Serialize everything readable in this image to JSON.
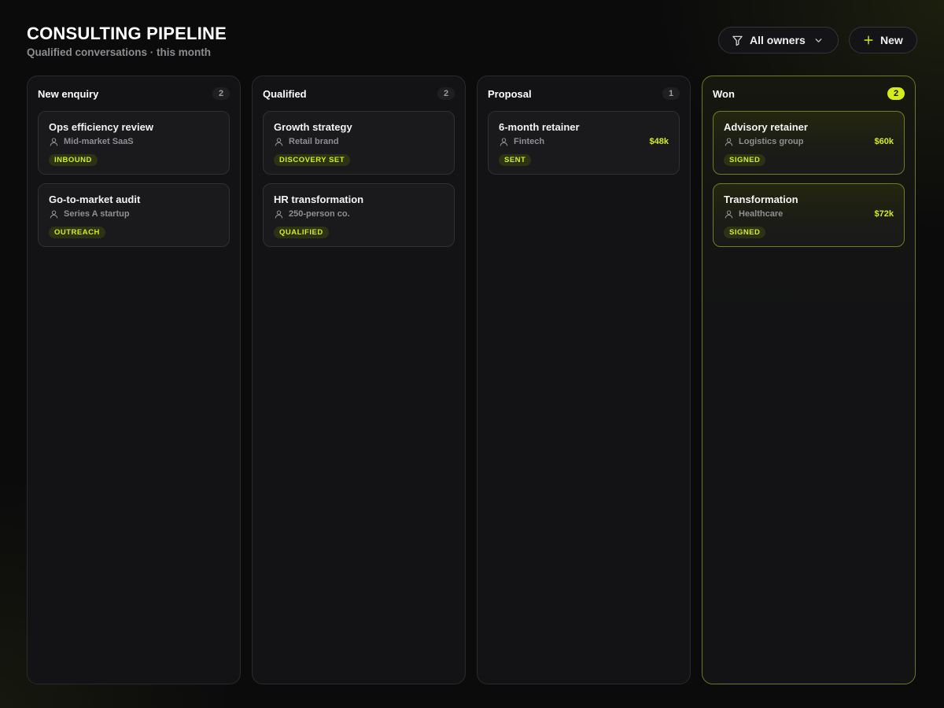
{
  "header": {
    "title": "CONSULTING PIPELINE",
    "subtitle": "Qualified conversations · this month"
  },
  "toolbar": {
    "owner_filter_label": "All owners",
    "new_label": "New"
  },
  "colors": {
    "accent": "#d4ec1c",
    "background": "#0b0b0c",
    "column": "#131315",
    "card": "#1a1a1d"
  },
  "icons": [
    "filter-icon",
    "chevron-down-icon",
    "plus-icon",
    "person-icon"
  ],
  "columns": [
    {
      "title": "New enquiry",
      "count": "2",
      "cards": [
        {
          "title": "Ops efficiency review",
          "client": "Mid-market SaaS",
          "value": "",
          "tag": "INBOUND"
        },
        {
          "title": "Go-to-market audit",
          "client": "Series A startup",
          "value": "",
          "tag": "OUTREACH"
        }
      ]
    },
    {
      "title": "Qualified",
      "count": "2",
      "cards": [
        {
          "title": "Growth strategy",
          "client": "Retail brand",
          "value": "",
          "tag": "DISCOVERY SET"
        },
        {
          "title": "HR transformation",
          "client": "250-person co.",
          "value": "",
          "tag": "QUALIFIED"
        }
      ]
    },
    {
      "title": "Proposal",
      "count": "1",
      "cards": [
        {
          "title": "6-month retainer",
          "client": "Fintech",
          "value": "$48k",
          "tag": "SENT"
        }
      ]
    },
    {
      "title": "Won",
      "count": "2",
      "cards": [
        {
          "title": "Advisory retainer",
          "client": "Logistics group",
          "value": "$60k",
          "tag": "SIGNED"
        },
        {
          "title": "Transformation",
          "client": "Healthcare",
          "value": "$72k",
          "tag": "SIGNED"
        }
      ]
    }
  ]
}
